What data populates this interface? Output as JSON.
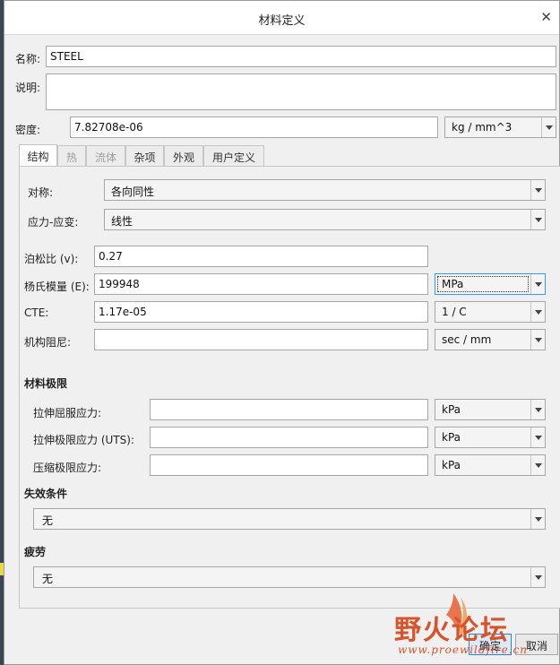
{
  "dialog": {
    "title": "材料定义"
  },
  "name": {
    "label": "名称:",
    "value": "STEEL"
  },
  "description": {
    "label": "说明:",
    "value": ""
  },
  "density": {
    "label": "密度:",
    "value": "7.82708e-06",
    "unit": "kg / mm^3"
  },
  "tabs": [
    {
      "label": "结构",
      "active": true,
      "disabled": false
    },
    {
      "label": "热",
      "active": false,
      "disabled": true
    },
    {
      "label": "流体",
      "active": false,
      "disabled": true
    },
    {
      "label": "杂项",
      "active": false,
      "disabled": false
    },
    {
      "label": "外观",
      "active": false,
      "disabled": false
    },
    {
      "label": "用户定义",
      "active": false,
      "disabled": false
    }
  ],
  "structure": {
    "symmetry": {
      "label": "对称:",
      "value": "各向同性"
    },
    "stress_strain": {
      "label": "应力-应变:",
      "value": "线性"
    },
    "poisson": {
      "label": "泊松比 (v):",
      "value": "0.27"
    },
    "young": {
      "label": "杨氏模量 (E):",
      "value": "199948",
      "unit": "MPa"
    },
    "cte": {
      "label": "CTE:",
      "value": "1.17e-05",
      "unit": "1 / C"
    },
    "damping": {
      "label": "机构阻尼:",
      "value": "",
      "unit": "sec / mm"
    }
  },
  "limits": {
    "title": "材料极限",
    "tensile_yield": {
      "label": "拉伸屈服应力:",
      "value": "",
      "unit": "kPa"
    },
    "tensile_ultimate": {
      "label": "拉伸极限应力 (UTS):",
      "value": "",
      "unit": "kPa"
    },
    "compressive_ultimate": {
      "label": "压缩极限应力:",
      "value": "",
      "unit": "kPa"
    }
  },
  "failure": {
    "title": "失效条件",
    "value": "无"
  },
  "fatigue": {
    "title": "疲劳",
    "value": "无"
  },
  "footer": {
    "ok": "确定",
    "cancel": "取消"
  },
  "watermark": {
    "main": "野火论坛",
    "url": "www.proewildfire.cn"
  },
  "colors": {
    "focus_border": "#3399ff",
    "primary_button": "#2f7fd8",
    "watermark": "#d9532a"
  }
}
